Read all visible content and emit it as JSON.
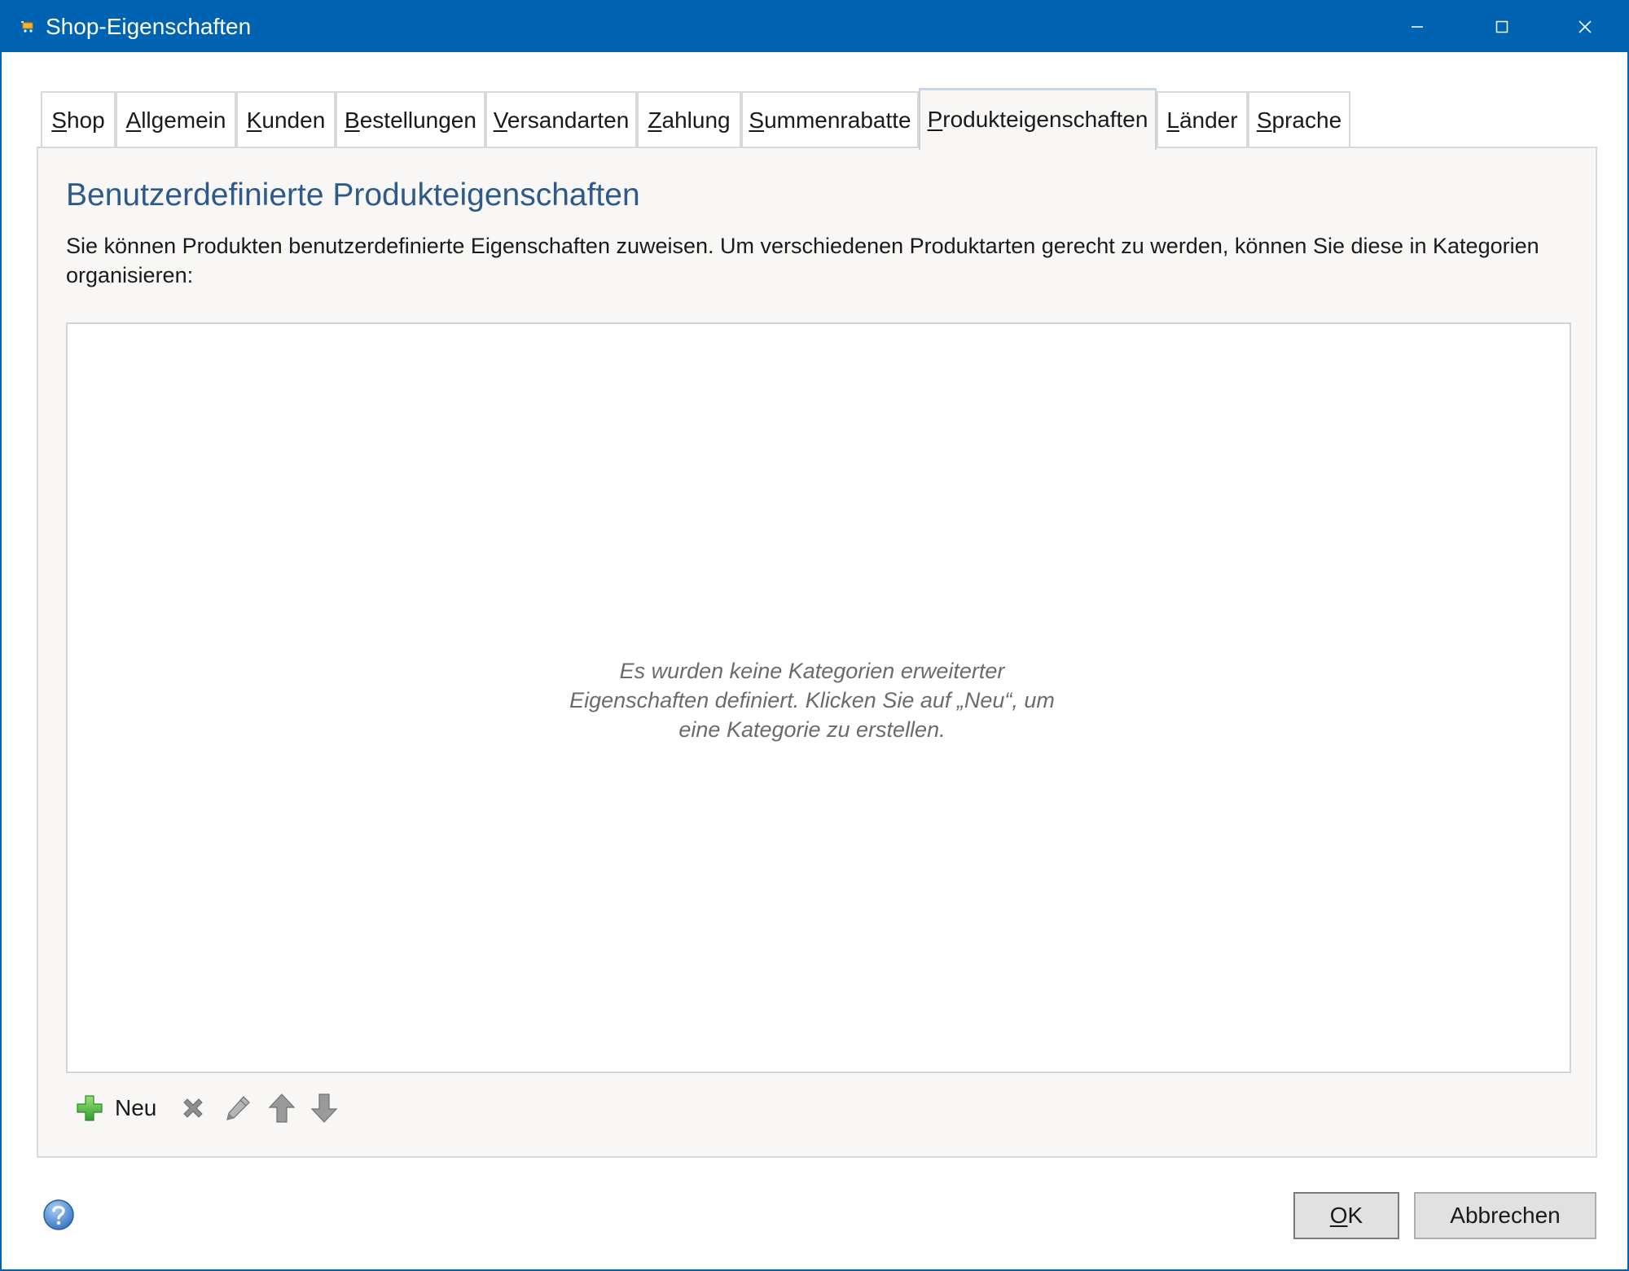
{
  "window": {
    "title": "Shop-Eigenschaften",
    "accent_color": "#0063b1",
    "controls": [
      "minimize-icon",
      "maximize-icon",
      "close-icon"
    ]
  },
  "tabs": [
    {
      "label": "Shop",
      "mnemonic": "S",
      "active": false
    },
    {
      "label": "Allgemein",
      "mnemonic": "A",
      "active": false
    },
    {
      "label": "Kunden",
      "mnemonic": "K",
      "active": false
    },
    {
      "label": "Bestellungen",
      "mnemonic": "B",
      "active": false
    },
    {
      "label": "Versandarten",
      "mnemonic": "V",
      "active": false
    },
    {
      "label": "Zahlung",
      "mnemonic": "Z",
      "active": false
    },
    {
      "label": "Summenrabatte",
      "mnemonic": "S",
      "active": false
    },
    {
      "label": "Produkteigenschaften",
      "mnemonic": "P",
      "active": true
    },
    {
      "label": "Länder",
      "mnemonic": "L",
      "active": false
    },
    {
      "label": "Sprache",
      "mnemonic": "S",
      "active": false
    }
  ],
  "panel": {
    "title": "Benutzerdefinierte Produkteigenschaften",
    "description": "Sie können Produkten benutzerdefinierte Eigenschaften zuweisen. Um verschiedenen Produktarten gerecht zu werden, können Sie diese in Kategorien organisieren:",
    "empty_message": "Es wurden keine Kategorien erweiterter Eigenschaften definiert. Klicken Sie auf „Neu“, um eine Kategorie zu erstellen."
  },
  "toolbar": {
    "new_label": "Neu",
    "icons": [
      "add-icon",
      "delete-icon",
      "edit-icon",
      "move-up-icon",
      "move-down-icon"
    ]
  },
  "footer": {
    "ok_label": "OK",
    "ok_mnemonic": "O",
    "cancel_label": "Abbrechen",
    "help_icon": "help-icon"
  }
}
